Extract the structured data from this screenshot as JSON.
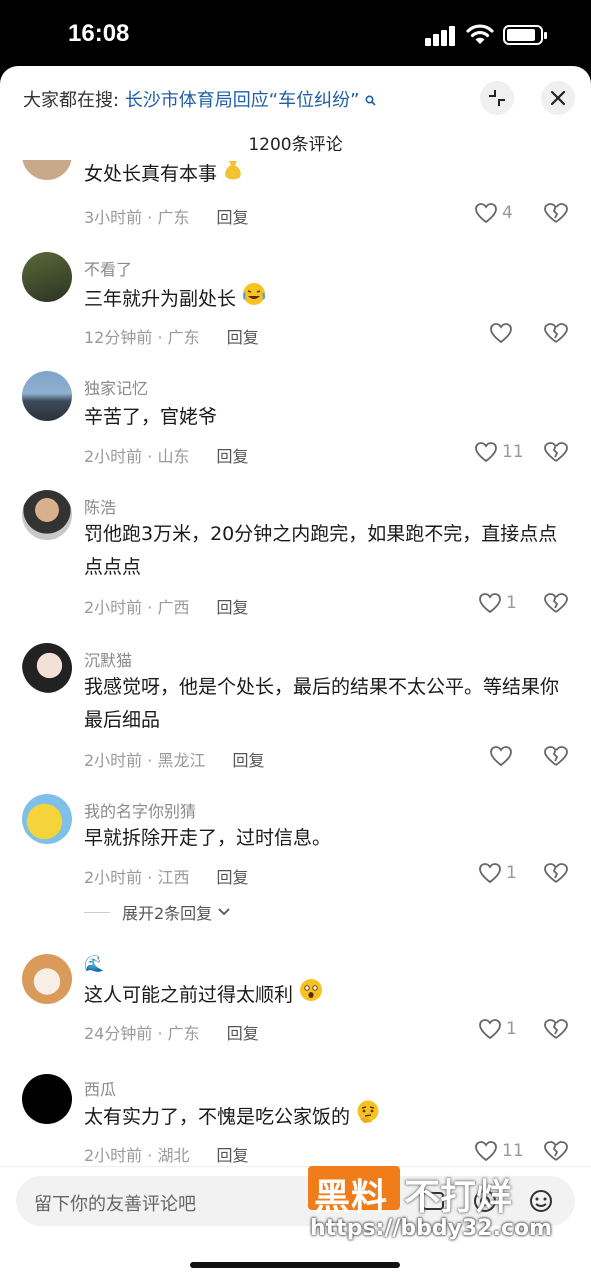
{
  "status_bar": {
    "time": "16:08"
  },
  "header": {
    "search_prefix": "大家都在搜:",
    "search_topic": "长沙市体育局回应“车位纠纷”",
    "comment_count": "1200条评论"
  },
  "comments": [
    {
      "username": "",
      "text": "女处长真有本事",
      "time_location": "3小时前 · 广东",
      "reply_label": "回复",
      "likes": "4"
    },
    {
      "username": "不看了",
      "text": "三年就升为副处长",
      "time_location": "12分钟前 · 广东",
      "reply_label": "回复",
      "likes": ""
    },
    {
      "username": "独家记忆",
      "text": "辛苦了，官姥爷",
      "time_location": "2小时前 · 山东",
      "reply_label": "回复",
      "likes": "11"
    },
    {
      "username": "陈浩",
      "text": "罚他跑3万米，20分钟之内跑完，如果跑不完，直接点点点点点",
      "time_location": "2小时前 · 广西",
      "reply_label": "回复",
      "likes": "1"
    },
    {
      "username": "沉默猫",
      "text": "我感觉呀，他是个处长，最后的结果不太公平。等结果你最后细品",
      "time_location": "2小时前 · 黑龙江",
      "reply_label": "回复",
      "likes": ""
    },
    {
      "username": "我的名字你别猜",
      "text": "早就拆除开走了，过时信息。",
      "time_location": "2小时前 · 江西",
      "reply_label": "回复",
      "likes": "1",
      "expand_label": "展开2条回复"
    },
    {
      "username": "🌊",
      "text": "这人可能之前过得太顺利",
      "time_location": "24分钟前 · 广东",
      "reply_label": "回复",
      "likes": "1"
    },
    {
      "username": "西瓜",
      "text": "太有实力了，不愧是吃公家饭的",
      "time_location": "2小时前 · 湖北",
      "reply_label": "回复",
      "likes": "11"
    }
  ],
  "input": {
    "placeholder": "留下你的友善评论吧"
  },
  "watermark": {
    "brand_a": "黑料",
    "brand_b": "不打烊",
    "url": "https://bbdy32.com"
  },
  "icons": {
    "like": "heart-outline-icon",
    "dislike": "broken-heart-icon",
    "close": "close-icon",
    "collapse": "collapse-icon",
    "search": "search-icon"
  }
}
